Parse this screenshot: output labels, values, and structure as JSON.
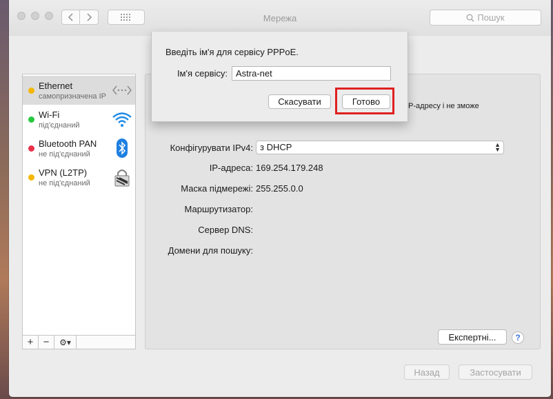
{
  "window": {
    "title": "Мережа"
  },
  "search": {
    "placeholder": "Пошук"
  },
  "toolbar": {
    "back_icon": "chevron-left-icon",
    "forward_icon": "chevron-right-icon",
    "grid_icon": "grid-icon"
  },
  "sidebar": {
    "items": [
      {
        "name": "Ethernet",
        "status": "самопризначена IP",
        "dot_color": "#f5b800",
        "icon": "ethernet-icon",
        "selected": true
      },
      {
        "name": "Wi-Fi",
        "status": "під'єднаний",
        "dot_color": "#28c940",
        "icon": "wifi-icon",
        "selected": false
      },
      {
        "name": "Bluetooth PAN",
        "status": "не під'єднаний",
        "dot_color": "#e8314a",
        "icon": "bluetooth-icon",
        "selected": false
      },
      {
        "name": "VPN (L2TP)",
        "status": "не під'єднаний",
        "dot_color": "#f5b800",
        "icon": "vpn-lock-icon",
        "selected": false
      }
    ],
    "add_label": "+",
    "remove_label": "−",
    "gear_label": "⚙︎▾"
  },
  "panel": {
    "status_text": "IP-адресу і не зможе",
    "config_label": "Конфігурувати IPv4:",
    "config_value": "з DHCP",
    "ip_label": "IP-адреса:",
    "ip_value": "169.254.179.248",
    "mask_label": "Маска підмережі:",
    "mask_value": "255.255.0.0",
    "router_label": "Маршрутизатор:",
    "dns_label": "Сервер DNS:",
    "domains_label": "Домени для пошуку:",
    "expert_button": "Експертні...",
    "help_label": "?"
  },
  "footer": {
    "back_button": "Назад",
    "apply_button": "Застосувати"
  },
  "sheet": {
    "prompt": "Введіть ім'я для сервісу PPPoE.",
    "service_label": "Ім'я сервісу:",
    "service_value": "Astra-net",
    "cancel_button": "Скасувати",
    "done_button": "Готово"
  },
  "colors": {
    "highlight": "#e02020",
    "accent": "#3a74d8"
  }
}
